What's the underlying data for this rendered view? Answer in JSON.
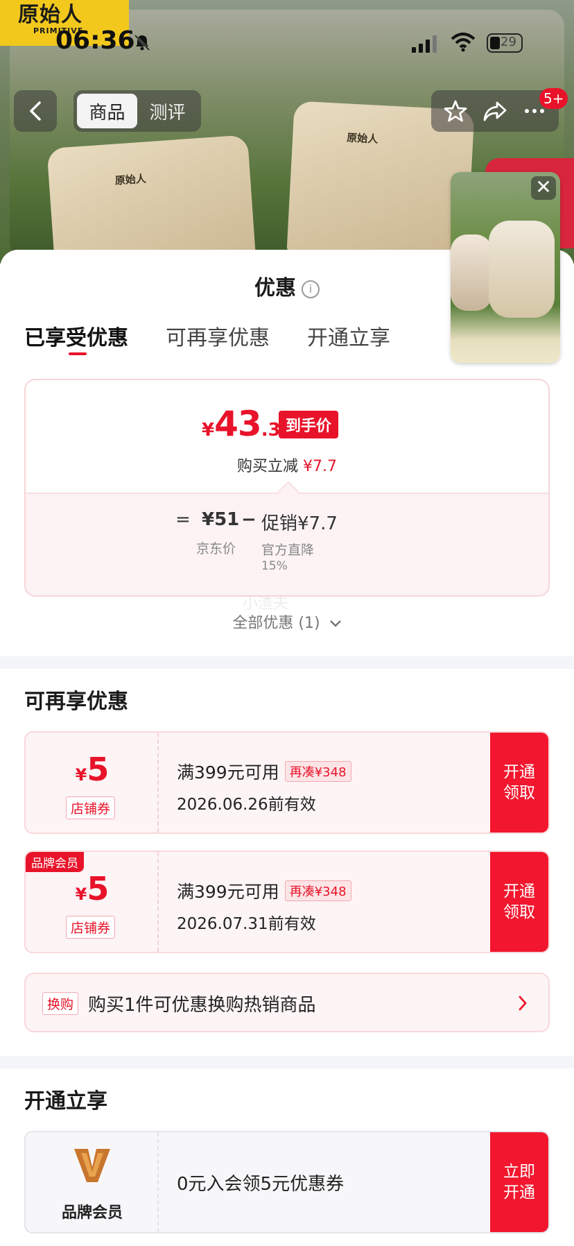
{
  "status_bar": {
    "time": "06:36",
    "battery": "29"
  },
  "brand_logo": {
    "cn": "原始人",
    "en": "PRIMITIVE"
  },
  "product_marks": {
    "chair": "原始人"
  },
  "nav": {
    "tabs": [
      {
        "label": "商品"
      },
      {
        "label": "测评"
      }
    ],
    "message_badge": "5+"
  },
  "float_video": {
    "close": "✕"
  },
  "sheet": {
    "title": "优惠",
    "tabs": [
      {
        "label": "已享受优惠"
      },
      {
        "label": "可再享优惠"
      },
      {
        "label": "开通立享"
      }
    ]
  },
  "price_card": {
    "currency": "¥",
    "price_int": "43",
    "price_dec": ".3",
    "price_tag": "到手价",
    "reduce_label": "购买立减",
    "reduce_value": "¥7.7",
    "equals": "=",
    "jd_price": "¥51",
    "jd_price_label": "京东价",
    "minus": "−",
    "promo": "促销¥7.7",
    "promo_label": "官方直降",
    "promo_pct": "15%"
  },
  "all_offers": "全部优惠 (1)",
  "watermark": "小渣夫",
  "reusable": {
    "title": "可再享优惠",
    "coupons": [
      {
        "amount": "5",
        "kind": "店铺券",
        "condition": "满399元可用",
        "more": "再凑¥348",
        "valid": "2026.06.26前有效",
        "button": "开通领取"
      },
      {
        "flag": "品牌会员",
        "amount": "5",
        "kind": "店铺券",
        "condition": "满399元可用",
        "more": "再凑¥348",
        "valid": "2026.07.31前有效",
        "button": "开通领取"
      }
    ],
    "swap": {
      "tag": "换购",
      "text": "购买1件可优惠换购热销商品"
    }
  },
  "open_now": {
    "title": "开通立享",
    "member": {
      "label": "品牌会员",
      "text": "0元入会领5元优惠券",
      "button": "立即开通"
    }
  },
  "colors": {
    "accent": "#e8132a",
    "coupon_bg": "#fdf4f5"
  }
}
